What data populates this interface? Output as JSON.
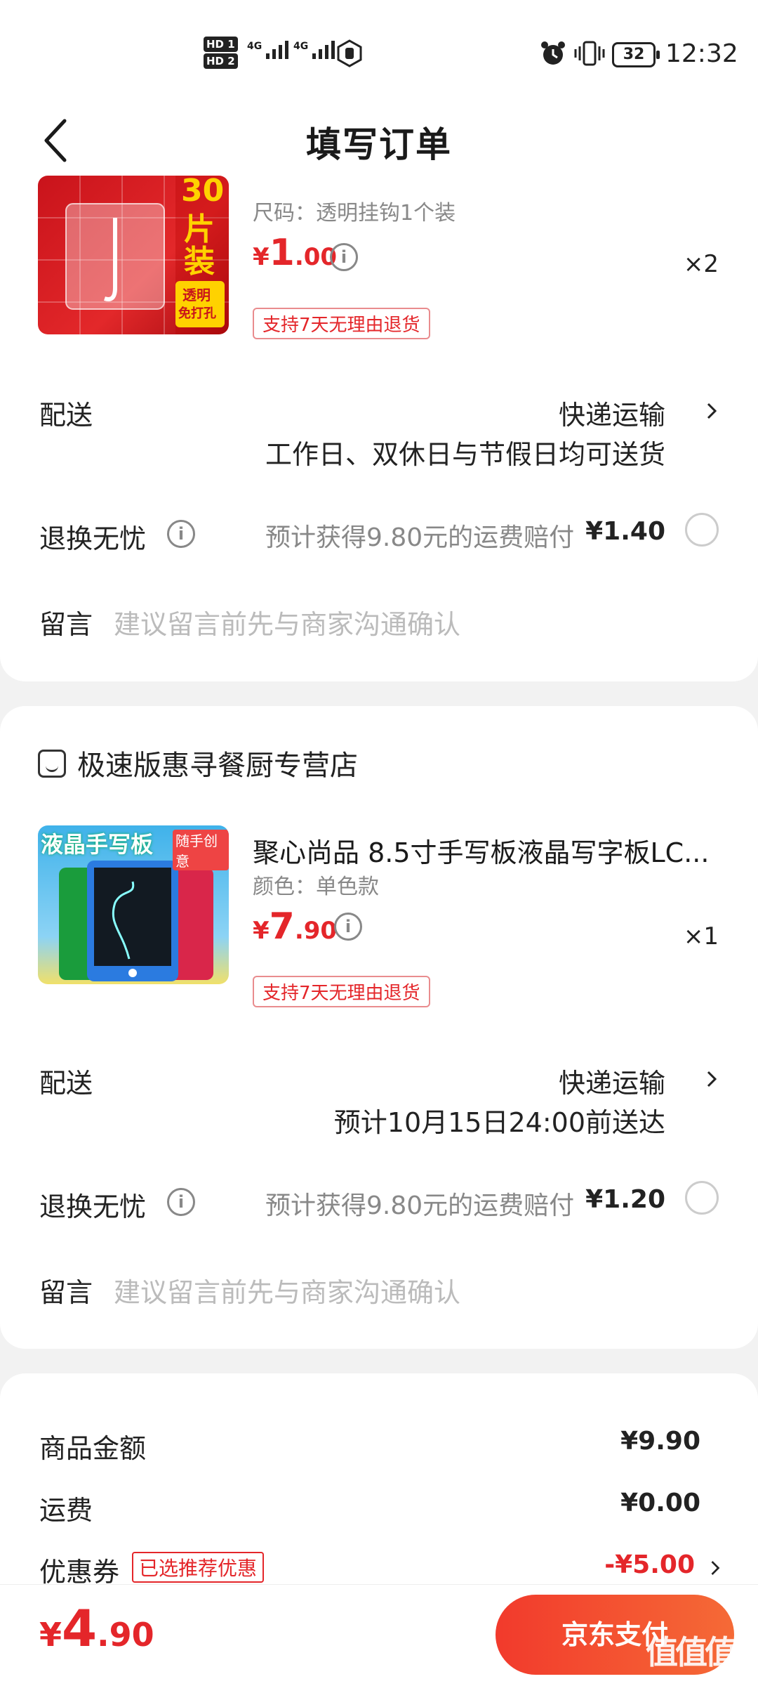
{
  "status_bar": {
    "sim1": "HD 1",
    "sim2": "HD 2",
    "net1": "4G",
    "net2": "4G",
    "battery": "32",
    "time": "12:32",
    "icons": [
      "hand-icon",
      "alarm-icon",
      "vibrate-icon"
    ]
  },
  "header": {
    "title": "填写订单"
  },
  "order1": {
    "product": {
      "spec": "尺码：透明挂钩1个装",
      "price_symbol": "¥",
      "price_int": "1",
      "price_dec": ".00",
      "quantity": "×2",
      "return_badge": "支持7天无理由退货",
      "thumb_text": {
        "big": "片",
        "pack": "装",
        "tag1": "透明",
        "tag2": "免打孔",
        "num": "30"
      }
    },
    "delivery": {
      "label": "配送",
      "method": "快递运输",
      "note": "工作日、双休日与节假日均可送货"
    },
    "worry_free": {
      "label": "退换无忧",
      "hint": "预计获得9.80元的运费赔付",
      "fee": "¥1.40"
    },
    "message": {
      "label": "留言",
      "placeholder": "建议留言前先与商家沟通确认"
    }
  },
  "order2": {
    "shop_name": "极速版惠寻餐厨专营店",
    "product": {
      "title": "聚心尚品 8.5寸手写板液晶写字板LC...",
      "spec": "颜色：单色款",
      "price_symbol": "¥",
      "price_int": "7",
      "price_dec": ".90",
      "quantity": "×1",
      "return_badge": "支持7天无理由退货",
      "thumb_text": {
        "title": "液晶手写板",
        "tag": "随手创意"
      }
    },
    "delivery": {
      "label": "配送",
      "method": "快递运输",
      "note": "预计10月15日24:00前送达"
    },
    "worry_free": {
      "label": "退换无忧",
      "hint": "预计获得9.80元的运费赔付",
      "fee": "¥1.20"
    },
    "message": {
      "label": "留言",
      "placeholder": "建议留言前先与商家沟通确认"
    }
  },
  "summary": {
    "goods_label": "商品金额",
    "goods_value": "¥9.90",
    "shipping_label": "运费",
    "shipping_value": "¥0.00",
    "coupon_label": "优惠券",
    "coupon_badge": "已选推荐优惠",
    "coupon_value": "-¥5.00"
  },
  "footer": {
    "total_symbol": "¥",
    "total_int": "4",
    "total_dec": ".90",
    "pay_button": "京东支付",
    "watermark": "值值值"
  },
  "colors": {
    "accent": "#e4262a",
    "pay_gradient_start": "#f23a2c",
    "pay_gradient_end": "#f56a36"
  }
}
